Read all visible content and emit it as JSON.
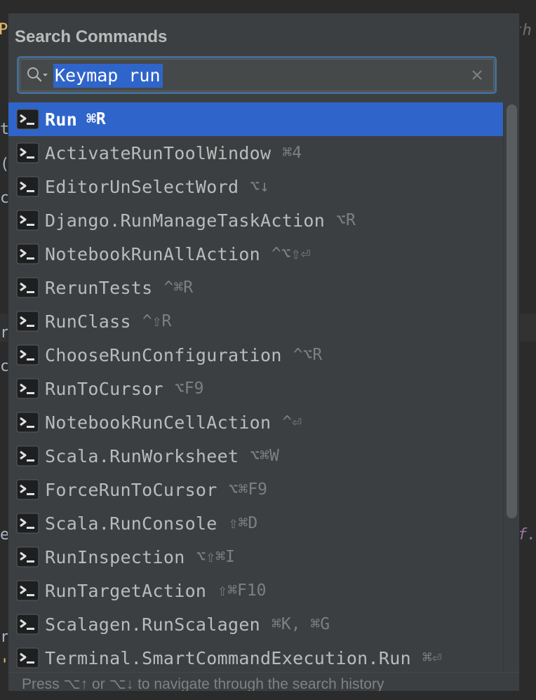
{
  "popup": {
    "title": "Search Commands",
    "search": {
      "value": "Keymap run"
    },
    "footer_hint": "Press ⌥↑ or ⌥↓ to navigate through the search history"
  },
  "items": [
    {
      "name": "Run",
      "shortcut": "⌘R"
    },
    {
      "name": "ActivateRunToolWindow",
      "shortcut": "⌘4"
    },
    {
      "name": "EditorUnSelectWord",
      "shortcut": "⌥↓"
    },
    {
      "name": "Django.RunManageTaskAction",
      "shortcut": "⌥R"
    },
    {
      "name": "NotebookRunAllAction",
      "shortcut": "^⌥⇧⏎"
    },
    {
      "name": "RerunTests",
      "shortcut": "^⌘R"
    },
    {
      "name": "RunClass",
      "shortcut": "^⇧R"
    },
    {
      "name": "ChooseRunConfiguration",
      "shortcut": "^⌥R"
    },
    {
      "name": "RunToCursor",
      "shortcut": "⌥F9"
    },
    {
      "name": "NotebookRunCellAction",
      "shortcut": "^⏎"
    },
    {
      "name": "Scala.RunWorksheet",
      "shortcut": "⌥⌘W"
    },
    {
      "name": "ForceRunToCursor",
      "shortcut": "⌥⌘F9"
    },
    {
      "name": "Scala.RunConsole",
      "shortcut": "⇧⌘D"
    },
    {
      "name": "RunInspection",
      "shortcut": "⌥⇧⌘I"
    },
    {
      "name": "RunTargetAction",
      "shortcut": "⇧⌘F10"
    },
    {
      "name": "Scalagen.RunScalagen",
      "shortcut": "⌘K, ⌘G"
    },
    {
      "name": "Terminal.SmartCommandExecution.Run",
      "shortcut": "⌘⏎"
    }
  ],
  "background_editor": {
    "fragments": [
      {
        "text": "Pa"
      },
      {
        "text": "ath"
      },
      {
        "text": "t"
      },
      {
        "text": "("
      },
      {
        "text": "c"
      },
      {
        "text": "r"
      },
      {
        "text": "c"
      },
      {
        "text": "e"
      },
      {
        "text": "f."
      },
      {
        "text": "re"
      },
      {
        "text": "'"
      }
    ]
  },
  "colors": {
    "accent_selection": "#2f65ca",
    "focus_border": "#466d94",
    "popup_bg": "#3c3f41",
    "editor_bg": "#2b2b2b"
  },
  "icons": {
    "search": "search-with-dropdown-icon",
    "clear": "close-icon",
    "action": "terminal-prompt-icon"
  }
}
